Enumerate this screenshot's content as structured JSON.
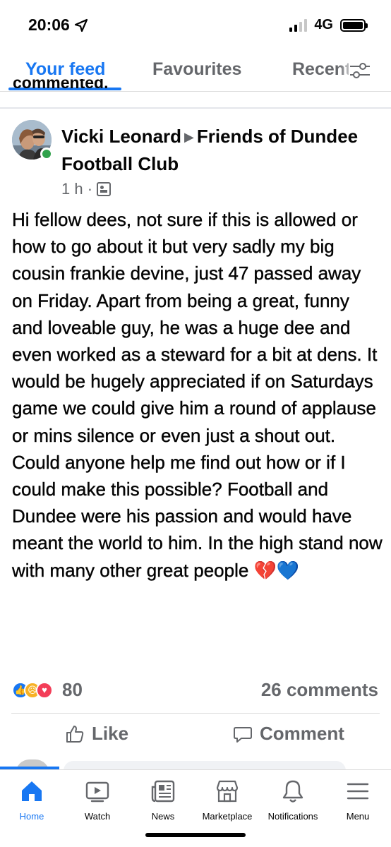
{
  "status_bar": {
    "time": "20:06",
    "network": "4G"
  },
  "tabs": [
    {
      "label": "Your feed",
      "active": true
    },
    {
      "label": "Favourites",
      "active": false
    },
    {
      "label": "Recent",
      "active": false
    }
  ],
  "previous_post_cut_text": "commented.",
  "post": {
    "author": "Vicki Leonard",
    "group": "Friends of Dundee Football Club",
    "time": "1 h ·",
    "body": "Hi fellow dees, not sure if this is allowed or how to go about it but very sadly my big cousin frankie devine, just 47  passed away on Friday. Apart from being a great, funny and loveable guy, he was a huge dee and even worked as a steward for a bit at dens. It would be hugely appreciated if on Saturdays game we could give him a round of applause or mins silence or even just a shout out. Could anyone help me find out how or if I could make this possible? Football and Dundee were his passion and would have meant the world to him. In the high stand now with many other great people 💔💙",
    "reaction_count": "80",
    "comments": "26 comments",
    "like_label": "Like",
    "comment_label": "Comment"
  },
  "icons": {
    "location": "location-arrow-icon",
    "reactions": [
      "like-reaction-icon",
      "sad-reaction-icon",
      "love-reaction-icon"
    ],
    "filter": "filter-sliders-icon"
  },
  "bottom_nav": [
    {
      "label": "Home",
      "icon": "home-icon",
      "active": true
    },
    {
      "label": "Watch",
      "icon": "watch-icon",
      "active": false
    },
    {
      "label": "News",
      "icon": "news-icon",
      "active": false
    },
    {
      "label": "Marketplace",
      "icon": "marketplace-icon",
      "active": false
    },
    {
      "label": "Notifications",
      "icon": "bell-icon",
      "active": false
    },
    {
      "label": "Menu",
      "icon": "menu-icon",
      "active": false
    }
  ],
  "colors": {
    "accent": "#1877f2",
    "secondary_text": "#65676b",
    "online": "#31a24c"
  }
}
